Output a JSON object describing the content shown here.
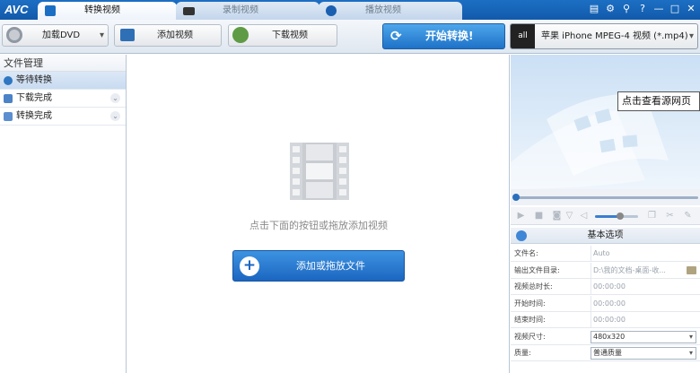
{
  "titlebar": {
    "app": "AVC",
    "tabs": [
      {
        "label": "转换视频"
      },
      {
        "label": "录制视频"
      },
      {
        "label": "播放视频"
      }
    ],
    "controls": {
      "list": "▤",
      "settings": "⚙",
      "search": "⚲",
      "help": "?",
      "minimize": "—",
      "maximize": "□",
      "close": "✕"
    }
  },
  "toolbar": {
    "load_dvd": "加载DVD",
    "add_video": "添加视频",
    "download_video": "下载视频",
    "start_convert": "开始转换!",
    "profile": "苹果 iPhone MPEG-4 视频 (*.mp4)"
  },
  "sidebar": {
    "title": "文件管理",
    "items": [
      {
        "label": "等待转换"
      },
      {
        "label": "下载完成"
      },
      {
        "label": "转换完成"
      }
    ]
  },
  "main": {
    "hint": "点击下面的按钮或拖放添加视频",
    "add_button": "添加或拖放文件"
  },
  "preview": {
    "tooltip": "点击查看源网页",
    "volume_level": 0.58
  },
  "options": {
    "title": "基本选项",
    "rows": [
      {
        "key": "文件名:",
        "value": "Auto"
      },
      {
        "key": "输出文件目录:",
        "value": "D:\\我的文档-桌面-收..."
      },
      {
        "key": "视频总时长:",
        "value": "00:00:00"
      },
      {
        "key": "开始时间:",
        "value": "00:00:00"
      },
      {
        "key": "结束时间:",
        "value": "00:00:00"
      },
      {
        "key": "视频尺寸:",
        "value": "480x320"
      },
      {
        "key": "质量:",
        "value": "普通质量"
      }
    ]
  },
  "colors": {
    "accent": "#1e72c8",
    "titlebar": "#1c6fc4"
  }
}
